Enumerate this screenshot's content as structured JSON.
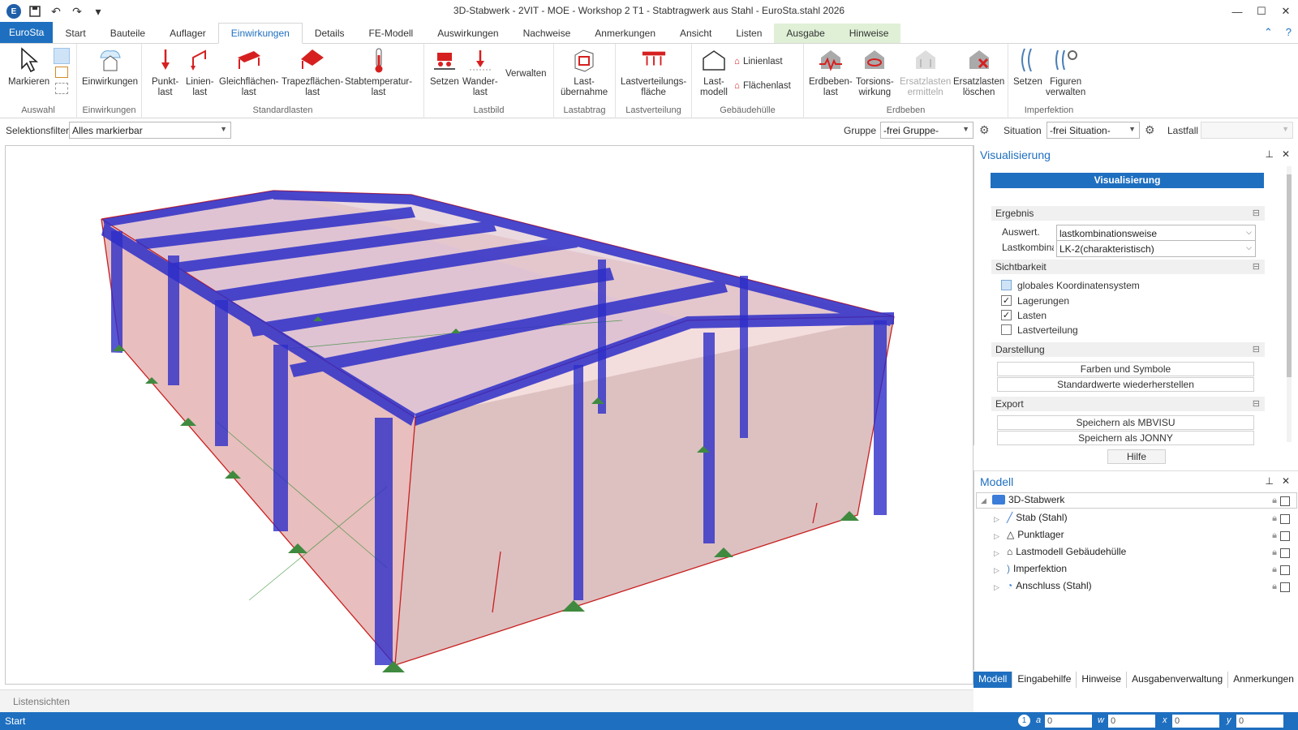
{
  "window": {
    "title": "3D-Stabwerk - 2VIT - MOE - Workshop 2 T1 - Stabtragwerk aus Stahl - EuroSta.stahl 2026"
  },
  "tabs": [
    "Start",
    "Bauteile",
    "Auflager",
    "Einwirkungen",
    "Details",
    "FE-Modell",
    "Auswirkungen",
    "Nachweise",
    "Anmerkungen",
    "Ansicht",
    "Listen",
    "Ausgabe",
    "Hinweise"
  ],
  "file_tab": "EuroSta",
  "ribbon": {
    "auswahl": {
      "label": "Auswahl",
      "markieren": "Markieren"
    },
    "einwirkungen": {
      "label": "Einwirkungen",
      "btn": "Einwirkungen"
    },
    "standardlasten": {
      "label": "Standardlasten",
      "punkt": "Punkt-\nlast",
      "linien": "Linien-\nlast",
      "gleich": "Gleichflächen-\nlast",
      "trapez": "Trapezflächen-\nlast",
      "stabtemp": "Stabtemperatur-\nlast"
    },
    "lastbild": {
      "label": "Lastbild",
      "setzen": "Setzen",
      "wander": "Wander-\nlast",
      "verwalten": "Verwalten"
    },
    "lastabtrag": {
      "label": "Lastabtrag",
      "btn": "Last-\nübernahme"
    },
    "lastverteilung": {
      "label": "Lastverteilung",
      "btn": "Lastverteilungs-\nfläche"
    },
    "gebaeude": {
      "label": "Gebäudehülle",
      "lastmodell": "Last-\nmodell",
      "linienlast": "Linienlast",
      "flaechenlast": "Flächenlast"
    },
    "erdbeben": {
      "label": "Erdbeben",
      "erdbebenlast": "Erdbeben-\nlast",
      "torsion": "Torsions-\nwirkung",
      "ermitteln": "Ersatzlasten\nermitteln",
      "loeschen": "Ersatzlasten\nlöschen"
    },
    "imperfektion": {
      "label": "Imperfektion",
      "setzen": "Setzen",
      "figuren": "Figuren\nverwalten"
    }
  },
  "selbar": {
    "filter_label": "Selektionsfilter",
    "filter_value": "Alles markierbar",
    "gruppe_label": "Gruppe",
    "gruppe_value": "-frei Gruppe-",
    "situation_label": "Situation",
    "situation_value": "-frei Situation-",
    "lastfall_label": "Lastfall",
    "lastfall_value": ""
  },
  "vis": {
    "title": "Visualisierung",
    "button": "Visualisierung",
    "ergebnis": "Ergebnis",
    "auswert_label": "Auswert.",
    "auswert_value": "lastkombinationsweise",
    "lastkomb_label": "Lastkombina",
    "lastkomb_value": "LK-2(charakteristisch)",
    "sichtbarkeit": "Sichtbarkeit",
    "items": [
      {
        "label": "globales Koordinatensystem",
        "checked": false
      },
      {
        "label": "Lagerungen",
        "checked": true
      },
      {
        "label": "Lasten",
        "checked": true
      },
      {
        "label": "Lastverteilung",
        "checked": false
      }
    ],
    "darstellung": "Darstellung",
    "farben": "Farben und Symbole",
    "standard": "Standardwerte wiederherstellen",
    "export": "Export",
    "mbvisu": "Speichern als MBVISU",
    "jonny": "Speichern als JONNY",
    "hilfe": "Hilfe"
  },
  "model": {
    "title": "Modell",
    "root": "3D-Stabwerk",
    "children": [
      "Stab (Stahl)",
      "Punktlager",
      "Lastmodell Gebäudehülle",
      "Imperfektion",
      "Anschluss (Stahl)"
    ]
  },
  "bottom_tabs": [
    "Modell",
    "Eingabehilfe",
    "Hinweise",
    "Ausgabenverwaltung",
    "Anmerkungen"
  ],
  "listbar": "Listensichten",
  "status": {
    "text": "Start",
    "a": "0",
    "w": "0",
    "x": "0",
    "y": "0"
  }
}
